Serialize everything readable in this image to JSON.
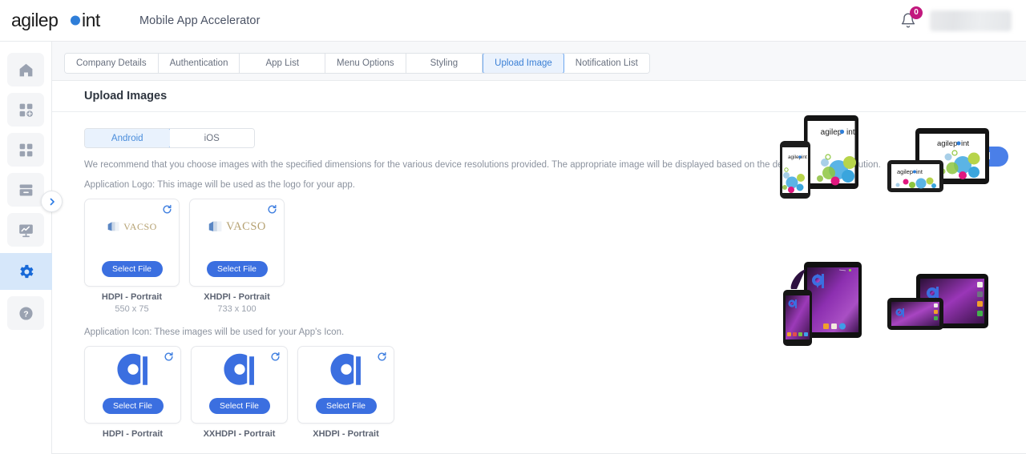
{
  "header": {
    "brand": "agilepoint",
    "app_title": "Mobile App Accelerator",
    "notification_count": "0",
    "bell_icon": "bell-icon",
    "user_name": ""
  },
  "sidebar": {
    "items": [
      {
        "icon": "home-icon",
        "name": "home"
      },
      {
        "icon": "app-add-icon",
        "name": "add-app"
      },
      {
        "icon": "apps-grid-icon",
        "name": "apps"
      },
      {
        "icon": "archive-icon",
        "name": "archive"
      },
      {
        "icon": "analytics-icon",
        "name": "analytics"
      },
      {
        "icon": "gear-icon",
        "name": "settings",
        "active": true
      },
      {
        "icon": "help-icon",
        "name": "help"
      }
    ],
    "expand_icon": "chevron-right-icon"
  },
  "tabs": [
    {
      "label": "Company Details",
      "active": false
    },
    {
      "label": "Authentication",
      "active": false
    },
    {
      "label": "App List",
      "active": false
    },
    {
      "label": "Menu Options",
      "active": false
    },
    {
      "label": "Styling",
      "active": false
    },
    {
      "label": "Upload Image",
      "active": true
    },
    {
      "label": "Notification List",
      "active": false
    }
  ],
  "panel": {
    "title": "Upload Images",
    "platform_toggle": [
      {
        "label": "Android",
        "active": true
      },
      {
        "label": "iOS",
        "active": false
      }
    ],
    "recommendation": "We recommend that you choose images with the specified dimensions for the various device resolutions provided. The appropriate image will be displayed based on the device's screen resolution.",
    "reset_label": "Reset All",
    "logo_section_label": "Application Logo: This image will be used as the logo for your app.",
    "icon_section_label": "Application Icon: These images will be used for your App's Icon.",
    "select_file_label": "Select File",
    "refresh_icon": "refresh-icon",
    "logo_cards": [
      {
        "preview": "vacso-logo",
        "caption": "HDPI - Portrait",
        "dims": "550 x 75"
      },
      {
        "preview": "vacso-logo",
        "caption": "XHDPI - Portrait",
        "dims": "733 x 100"
      }
    ],
    "icon_cards": [
      {
        "preview": "agilepoint-mark",
        "caption": "HDPI - Portrait",
        "dims": ""
      },
      {
        "preview": "agilepoint-mark",
        "caption": "XXHDPI - Portrait",
        "dims": ""
      },
      {
        "preview": "agilepoint-mark",
        "caption": "XHDPI - Portrait",
        "dims": ""
      }
    ],
    "device_previews": [
      {
        "name": "logo-phone-tablet-portrait"
      },
      {
        "name": "logo-phone-tablet-landscape"
      },
      {
        "name": "icon-phone-tablet-portrait"
      },
      {
        "name": "icon-phone-tablet-landscape"
      }
    ]
  },
  "colors": {
    "accent_blue": "#3b6fe0",
    "tab_active_blue": "#3a7fd5",
    "badge_magenta": "#c2187e",
    "sidebar_active_bg": "#d6e7fa",
    "page_bg": "#f7f8fa"
  }
}
